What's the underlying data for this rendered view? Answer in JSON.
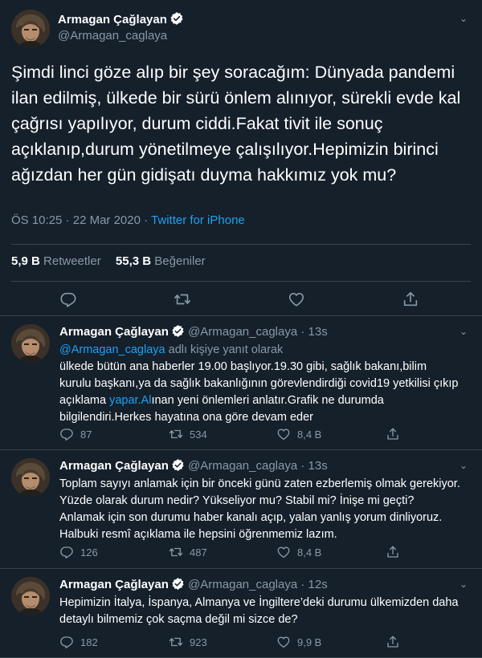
{
  "main_tweet": {
    "author_name": "Armagan Çağlayan",
    "handle": "@Armagan_caglaya",
    "text": "Şimdi linci göze alıp bir şey soracağım: Dünyada pandemi ilan edilmiş, ülkede bir sürü önlem alınıyor, sürekli evde kal çağrısı yapılıyor, durum ciddi.Fakat tivit ile sonuç açıklanıp,durum yönetilmeye çalışılıyor.Hepimizin birinci ağızdan her gün gidişatı duyma hakkımız yok mu?",
    "time": "ÖS 10:25",
    "date": "22 Mar 2020",
    "source": "Twitter for iPhone",
    "retweets_count": "5,9 B",
    "retweets_label": "Retweetler",
    "likes_count": "55,3 B",
    "likes_label": "Beğeniler"
  },
  "replies": [
    {
      "author_name": "Armagan Çağlayan",
      "handle": "@Armagan_caglaya",
      "age": "· 13s",
      "replying_handle": "@Armagan_caglaya",
      "replying_suffix": " adlı kişiye yanıt olarak",
      "text_before_link": "ülkede bütün ana haberler 19.00 başlıyor.19.30 gibi, sağlık bakanı,bilim kurulu başkanı,ya da sağlık bakanlığının görevlendirdiği covid19 yetkilisi çıkıp açıklama ",
      "link_text": "yapar.Al",
      "text_after_link": "ınan yeni önlemleri anlatır.Grafik ne durumda bilgilendiri.Herkes hayatına ona göre devam eder",
      "reply_count": "87",
      "retweet_count": "534",
      "like_count": "8,4 B"
    },
    {
      "author_name": "Armagan Çağlayan",
      "handle": "@Armagan_caglaya",
      "age": "· 13s",
      "text": "Toplam sayıyı anlamak için bir önceki günü zaten ezberlemiş olmak gerekiyor. Yüzde olarak durum nedir? Yükseliyor mu? Stabil mi? İnişe mi geçti? Anlamak için son durumu haber kanalı açıp, yalan yanlış yorum dinliyoruz. Halbuki resmî açıklama ile hepsini öğrenmemiz lazım.",
      "reply_count": "126",
      "retweet_count": "487",
      "like_count": "8,4 B"
    },
    {
      "author_name": "Armagan Çağlayan",
      "handle": "@Armagan_caglaya",
      "age": "· 12s",
      "text": "Hepimizin İtalya, İspanya, Almanya ve İngiltere’deki durumu ülkemizden daha detaylı bilmemiz çok saçma değil mi sizce de?",
      "reply_count": "182",
      "retweet_count": "923",
      "like_count": "9,9 B"
    }
  ],
  "icons": {
    "reply": "reply-icon",
    "retweet": "retweet-icon",
    "like": "like-icon",
    "share": "share-icon",
    "verified": "verified-badge-icon",
    "menu": "chevron-down-icon"
  },
  "colors": {
    "background": "#15202b",
    "accent": "#1da1f2",
    "secondary_text": "#8899a6",
    "divider": "#38444d"
  }
}
